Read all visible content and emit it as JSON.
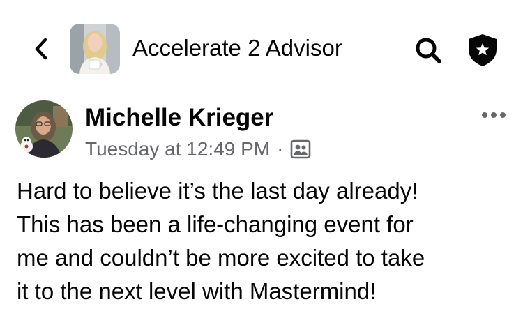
{
  "header": {
    "back_icon": "chevron-left-icon",
    "group_name": "Accelerate 2 Advisor",
    "search_icon": "search-icon",
    "admin_icon": "shield-star-icon"
  },
  "post": {
    "author_name": "Michelle Krieger",
    "timestamp": "Tuesday at 12:49 PM",
    "separator": "·",
    "audience_icon": "group-members-icon",
    "more_icon": "more-horizontal-icon",
    "text": "Hard to believe it’s the last day already!\nThis has been a life-changing event for\nme and couldn’t be more excited to take\nit to the next level with Mastermind!"
  },
  "colors": {
    "primary_text": "#050505",
    "secondary_text": "#65676b",
    "divider": "#dadde1",
    "background": "#ffffff"
  }
}
